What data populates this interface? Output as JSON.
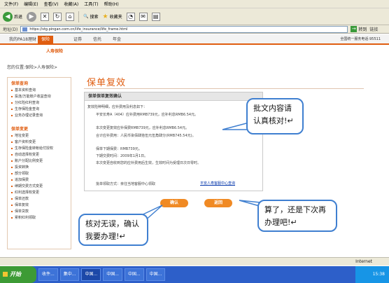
{
  "menu": [
    "文件(F)",
    "编辑(E)",
    "查看(V)",
    "收藏(A)",
    "工具(T)",
    "帮助(H)"
  ],
  "toolbar": {
    "back": "后退",
    "search": "搜索",
    "favorites": "收藏夹"
  },
  "address": {
    "label": "地址(D)",
    "url": "https://stg.pingan.com.cn/life_insurance/life_frame.html",
    "go": "转到",
    "links": "链接"
  },
  "site": {
    "nav_home": "我的PA18理财",
    "nav_tabs": [
      "保险",
      "证券",
      "信托",
      "年金"
    ],
    "hotline": "全国统一服务电话:95511",
    "sub_nav": "人寿保险",
    "breadcrumb": "您的位置:保险>人寿保险>"
  },
  "sidebar": {
    "section1_title": "保单查询",
    "section1_items": [
      "基本资料查询",
      "投连/万能账户收益查询",
      "分红险红利查询",
      "生存保险金查询",
      "业务办理记录查询"
    ],
    "section2_title": "保单变更",
    "section2_items": [
      "地址变更",
      "客户资料变更",
      "生存保险金转帐给付授权",
      "自动选择权变更",
      "账户分配比例变更",
      "投资转换",
      "部分领取",
      "追加保费",
      "续期交费方式变更",
      "红利选择权变更",
      "保单还款",
      "保单复效",
      "保单贷款",
      "累积红利领取"
    ]
  },
  "main": {
    "title": "保单复效",
    "panel_title": "保单保单复效确认",
    "lines": [
      "复效险种明细，应补费用及利息如下：",
      "平安长寿A（404）应补费用RMB739元，应补利息RMB6.54元。",
      "本次变更复效应补保费RMB739元，应补利息RMB6.54元。",
      "合计应补费用：人民币柒佰肆拾伍元伍角肆分(RMB745.54元)。",
      "保单下期保费：RMB739元。",
      "下期交费时间：2009年1月1日。",
      "本次变更自收到您的应补费用后生效，生效时间为受理日次日零时。"
    ],
    "pickup_label": "批单领取方式：亲往当地客服中心领取",
    "pickup_link": "平安人寿客服中心查询",
    "confirm_button": "确认",
    "back_button": "返回"
  },
  "callouts": {
    "top": "批文内容请认真核对!↵",
    "right": "算了，还是下次再办理吧!↵",
    "left": "核对无误，确认我要办理!↵"
  },
  "status": {
    "zone": "Internet"
  },
  "taskbar": {
    "start": "开始",
    "items": [
      "收件...",
      "集中...",
      "中国...",
      "中国...",
      "中国...",
      "中国..."
    ],
    "clock": "15:38"
  }
}
